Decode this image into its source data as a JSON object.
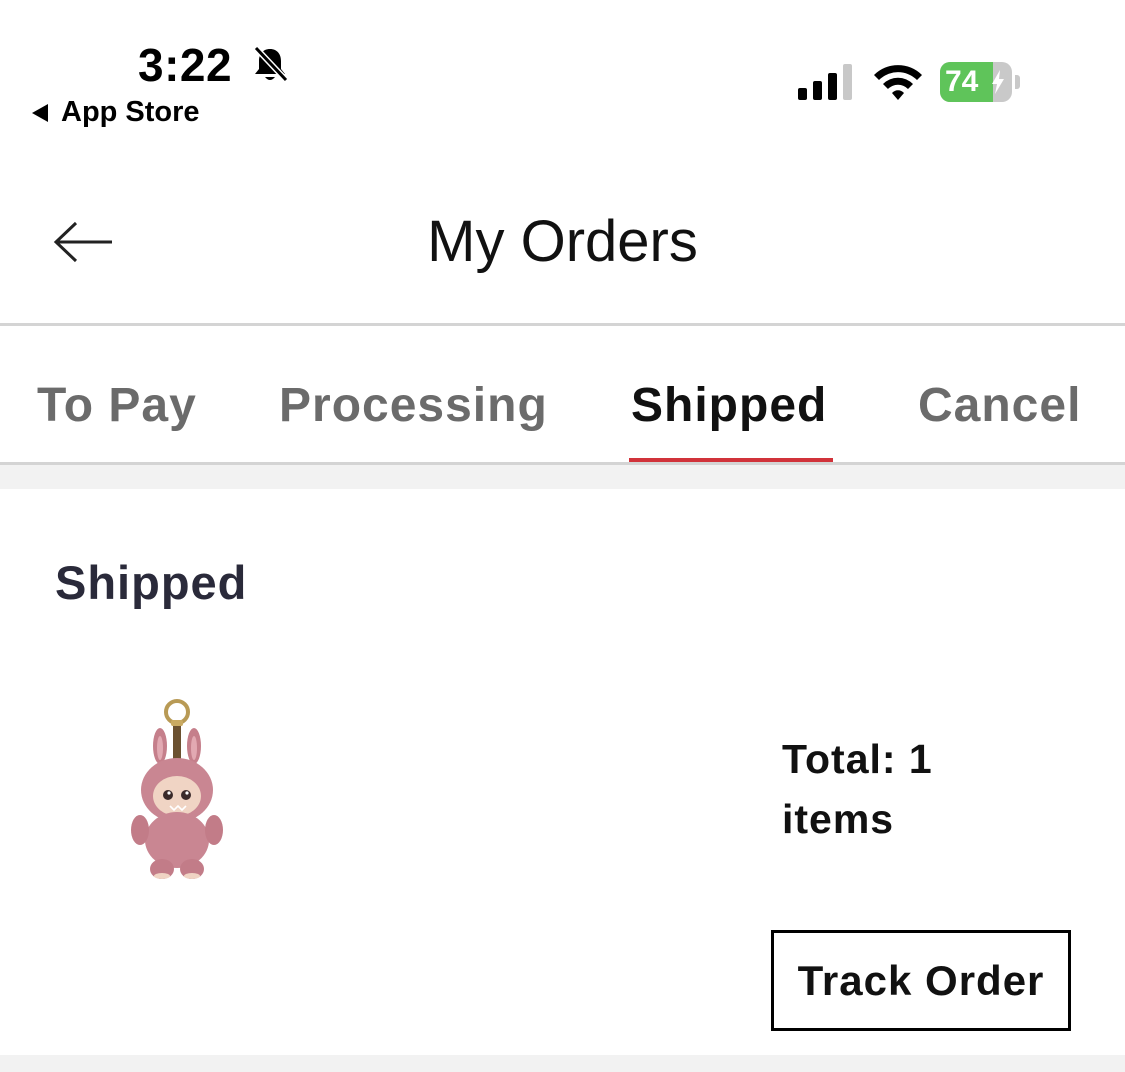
{
  "status_bar": {
    "time": "3:22",
    "back_app_label": "App Store",
    "battery_percent": "74",
    "battery_level": 0.74,
    "icons": [
      "bell-slash-icon",
      "signal-icon",
      "wifi-icon",
      "battery-icon",
      "charging-bolt-icon"
    ]
  },
  "header": {
    "title": "My Orders",
    "back_icon": "arrow-left-icon"
  },
  "tabs": [
    {
      "label": "To Pay",
      "active": false
    },
    {
      "label": "Processing",
      "active": false
    },
    {
      "label": "Shipped",
      "active": true
    },
    {
      "label": "Cancel",
      "active": false
    }
  ],
  "colors": {
    "accent": "#d1323a",
    "battery_green": "#5fc45a",
    "inactive_tab": "#6b6b6b"
  },
  "order": {
    "status": "Shipped",
    "total": "Total: 1 items",
    "product_image": "pink bunny plush keychain",
    "track_label": "Track Order"
  }
}
